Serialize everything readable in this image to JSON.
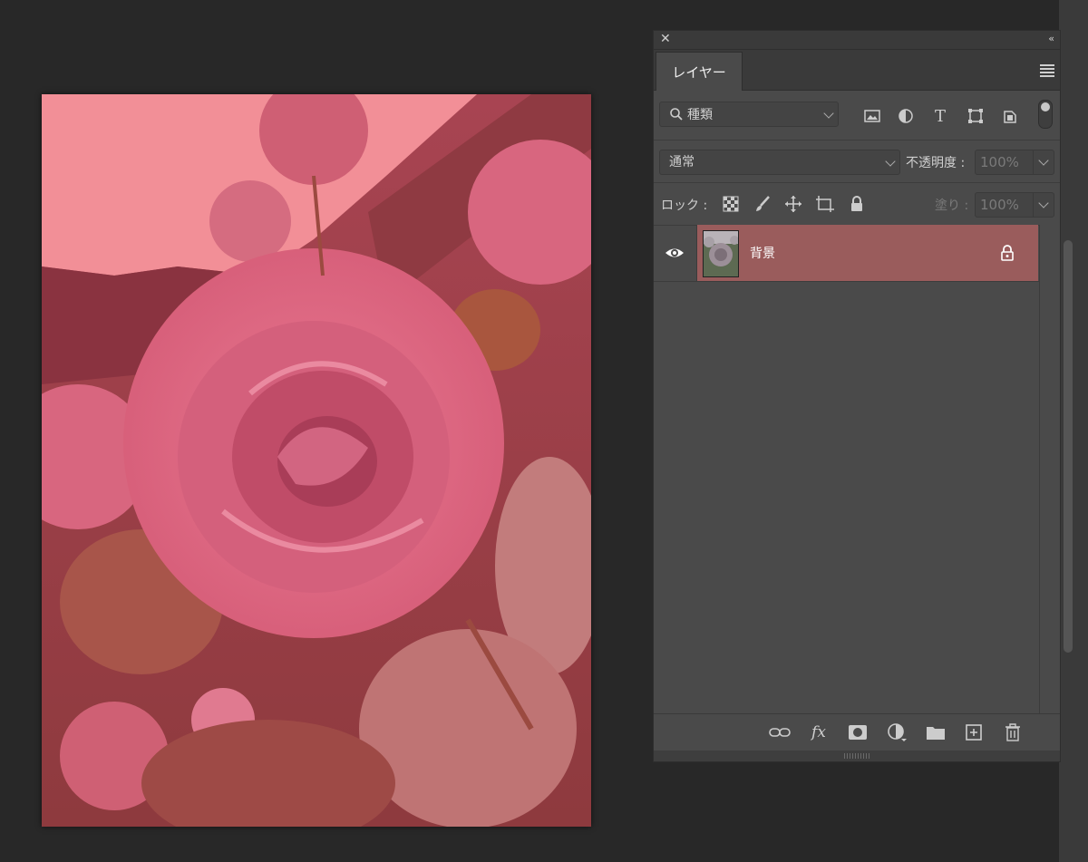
{
  "panel": {
    "tab_label": "レイヤー",
    "close_icon": "close-icon",
    "collapse_icon": "collapse-double-chevron-icon",
    "menu_icon": "panel-menu-icon"
  },
  "filter": {
    "search_value": "種類",
    "search_icon": "search-icon",
    "icons": [
      "image-filter-icon",
      "adjustment-filter-icon",
      "type-filter-icon",
      "shape-filter-icon",
      "smart-object-filter-icon"
    ]
  },
  "blend": {
    "mode": "通常",
    "opacity_label": "不透明度 :",
    "opacity_value": "100%"
  },
  "lock": {
    "label": "ロック :",
    "icons": [
      "lock-transparency-icon",
      "lock-paint-icon",
      "lock-position-icon",
      "lock-artboard-icon",
      "lock-all-icon"
    ],
    "fill_label": "塗り :",
    "fill_value": "100%"
  },
  "layers": [
    {
      "name": "背景",
      "visible": true,
      "locked": true,
      "selected": true
    }
  ],
  "bottom_icons": [
    "link-layers-icon",
    "fx-icon",
    "add-mask-icon",
    "adjustment-layer-icon",
    "new-group-icon",
    "new-layer-icon",
    "trash-icon"
  ],
  "bottom": {
    "fx_text": "fx"
  },
  "colors": {
    "selected_layer": "#9a5c5c",
    "panel_bg": "#4a4a4a",
    "workspace_bg": "#282828"
  }
}
